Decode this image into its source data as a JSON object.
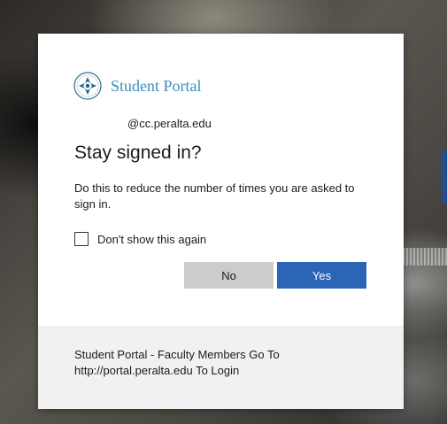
{
  "brand": {
    "name": "Student Portal",
    "color": "#3a8fb8",
    "logo_icon": "college-seal-icon"
  },
  "identity": {
    "account": "@cc.peralta.edu"
  },
  "prompt": {
    "title": "Stay signed in?",
    "description": "Do this to reduce the number of times you are asked to sign in.",
    "dont_show_label": "Don't show this again",
    "dont_show_checked": false
  },
  "buttons": {
    "no_label": "No",
    "yes_label": "Yes",
    "primary_color": "#2b66b6"
  },
  "footer": {
    "text": "Student Portal - Faculty Members Go To http://portal.peralta.edu To Login"
  }
}
